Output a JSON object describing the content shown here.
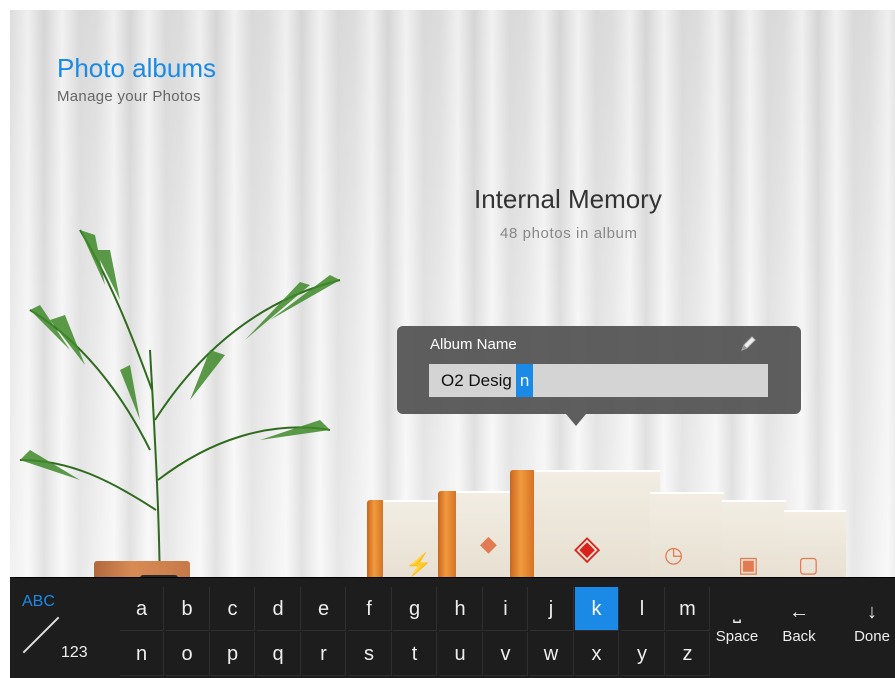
{
  "header": {
    "title": "Photo albums",
    "subtitle": "Manage your Photos"
  },
  "album": {
    "title": "Internal Memory",
    "count_text": "48  photos in album"
  },
  "editor": {
    "label": "Album Name",
    "value_text": "O2  Desig",
    "cursor_char": "n",
    "edit_icon": "pencil-icon"
  },
  "books": [
    {
      "icon": "usb-icon"
    },
    {
      "icon": "tag-icon"
    },
    {
      "icon": "gem-icon"
    },
    {
      "icon": "clock-icon"
    },
    {
      "icon": "image-star-icon"
    },
    {
      "icon": "image-question-icon"
    }
  ],
  "keyboard": {
    "mode_abc": "ABC",
    "mode_123": "123",
    "row1": [
      "a",
      "b",
      "c",
      "d",
      "e",
      "f",
      "g",
      "h",
      "i",
      "j",
      "k",
      "l",
      "m"
    ],
    "row2": [
      "n",
      "o",
      "p",
      "q",
      "r",
      "s",
      "t",
      "u",
      "v",
      "w",
      "x",
      "y",
      "z"
    ],
    "active_key": "k",
    "space_label": "Space",
    "back_label": "Back",
    "done_label": "Done",
    "accent_color": "#1a8ae6"
  }
}
